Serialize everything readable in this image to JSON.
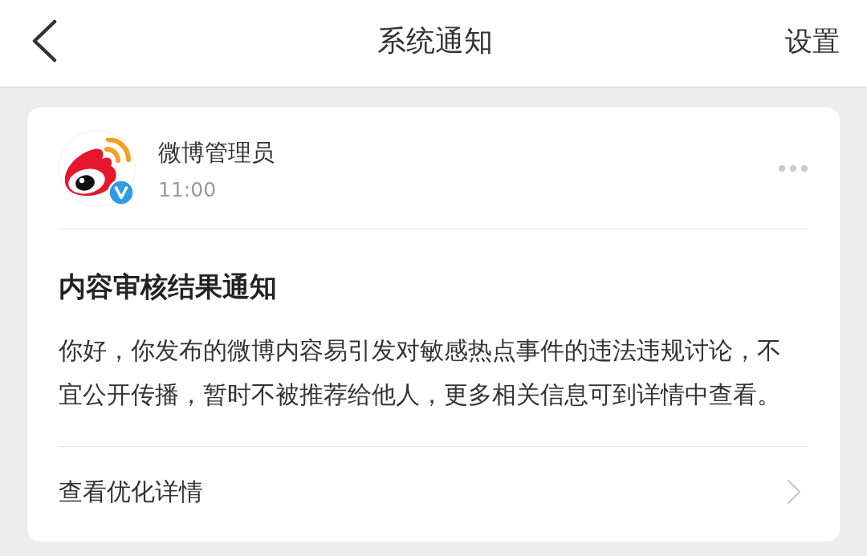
{
  "header": {
    "title": "系统通知",
    "settings_label": "设置"
  },
  "notification": {
    "sender": {
      "name": "微博管理员",
      "time": "11:00",
      "verified": true
    },
    "title": "内容审核结果通知",
    "body": "你好，你发布的微博内容易引发对敏感热点事件的违法违规讨论，不宜公开传播，暂时不被推荐给他人，更多相关信息可到详情中查看。",
    "link": {
      "label": "查看优化详情"
    }
  }
}
